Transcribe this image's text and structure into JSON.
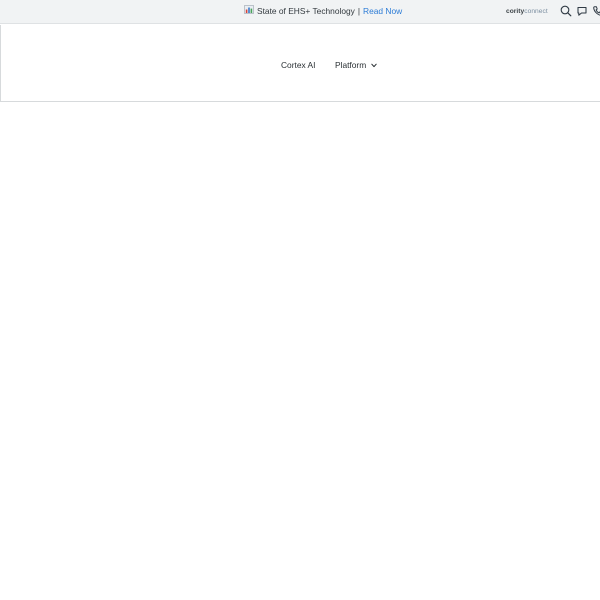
{
  "announcement": {
    "icon": "bar-chart-icon",
    "text": "State of EHS+ Technology",
    "separator": "|",
    "link_label": "Read Now",
    "link_color": "#2b7bd6"
  },
  "utility": {
    "brand_primary": "cority",
    "brand_secondary": "connect",
    "icons": [
      "search-icon",
      "chat-bubble-icon",
      "phone-icon"
    ]
  },
  "nav": {
    "items": [
      {
        "label": "Cortex AI",
        "has_dropdown": false
      },
      {
        "label": "Platform",
        "has_dropdown": true
      }
    ]
  },
  "colors": {
    "topbar_bg": "#f1f3f4",
    "text": "#2a3034",
    "link": "#2b7bd6"
  }
}
